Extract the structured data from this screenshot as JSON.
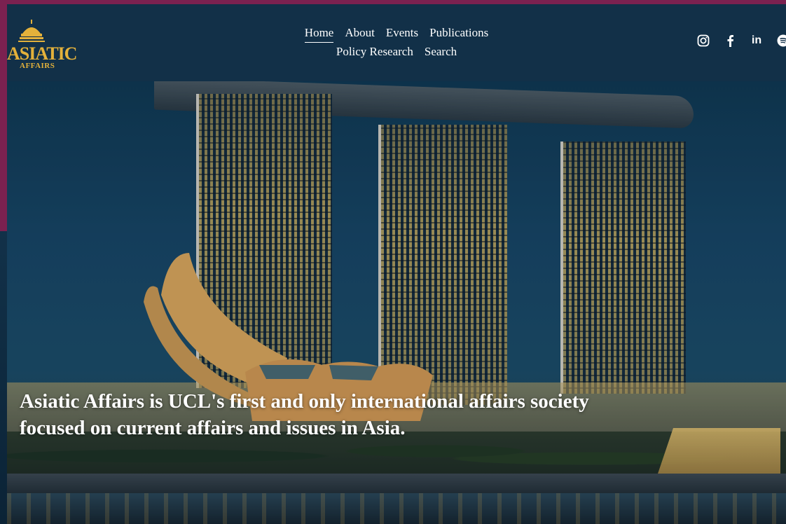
{
  "brand": {
    "name": "ASIATIC",
    "subtitle": "AFFAIRS",
    "colors": {
      "gold": "#e3b13b",
      "header_bg": "#123048",
      "frame_accent": "#7b2150"
    }
  },
  "nav": {
    "row1": [
      {
        "label": "Home",
        "active": true
      },
      {
        "label": "About",
        "active": false
      },
      {
        "label": "Events",
        "active": false
      },
      {
        "label": "Publications",
        "active": false
      }
    ],
    "row2": [
      {
        "label": "Policy Research",
        "active": false
      },
      {
        "label": "Search",
        "active": false
      }
    ]
  },
  "social": [
    "instagram-icon",
    "facebook-icon",
    "linkedin-icon",
    "spotify-icon"
  ],
  "social_labels": {
    "linkedin": "in"
  },
  "hero": {
    "tagline": "Asiatic Affairs is UCL's first and only international affairs society focused on current affairs and issues in Asia."
  }
}
